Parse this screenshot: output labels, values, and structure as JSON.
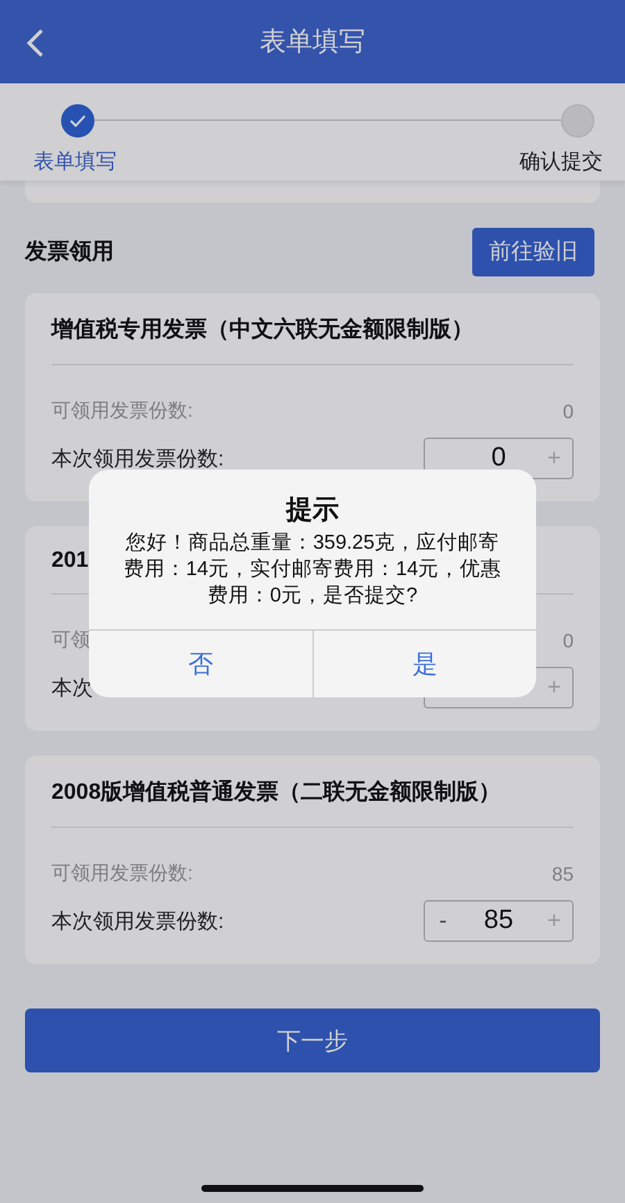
{
  "header": {
    "title": "表单填写"
  },
  "steps": [
    {
      "label": "表单填写",
      "done": true,
      "selected": true
    },
    {
      "label": "确认提交",
      "done": false,
      "selected": false
    }
  ],
  "section": {
    "title": "发票领用",
    "button": "前往验旧"
  },
  "cards": [
    {
      "title": "增值税专用发票（中文六联无金额限制版）",
      "available_label": "可领用发票份数:",
      "available_value": "0",
      "request_label": "本次领用发票份数:",
      "plus": "+",
      "quantity": "0"
    },
    {
      "title": "201",
      "available_label": "可领",
      "available_value": "0",
      "request_label": "本次",
      "plus": "+"
    },
    {
      "title": "2008版增值税普通发票（二联无金额限制版）",
      "available_label": "可领用发票份数:",
      "available_value": "85",
      "request_label": "本次领用发票份数:",
      "minus": "-",
      "plus": "+",
      "quantity": "85"
    }
  ],
  "next_button": "下一步",
  "dialog": {
    "title": "提示",
    "message": "您好！商品总重量：359.25克，应付邮寄费用：14元，实付邮寄费用：14元，优惠费用：0元，是否提交?",
    "buttons": [
      "否",
      "是"
    ]
  }
}
